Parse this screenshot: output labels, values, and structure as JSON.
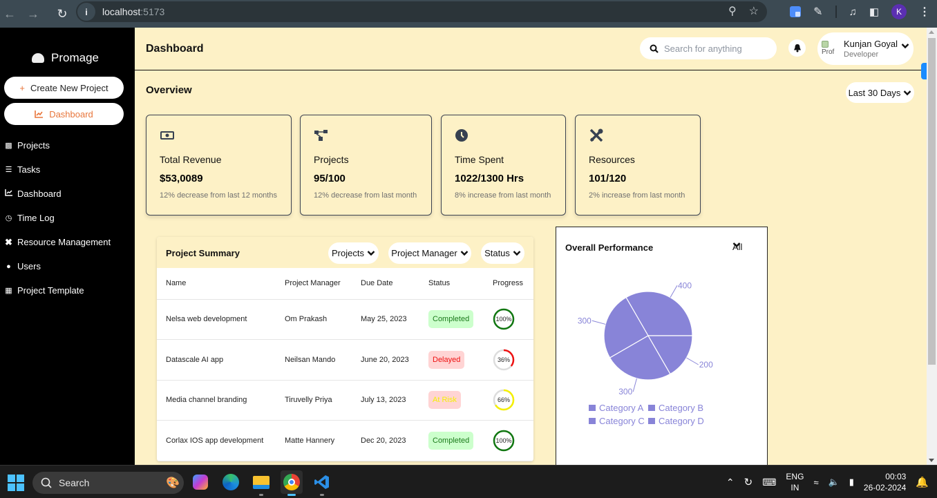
{
  "browser": {
    "url_host": "localhost",
    "url_port": ":5173",
    "profile_initial": "K"
  },
  "sidebar": {
    "brand": "Promage",
    "create_button": "Create New Project",
    "active_button": "Dashboard",
    "items": [
      {
        "label": "Projects",
        "icon": "project-diagram-icon"
      },
      {
        "label": "Tasks",
        "icon": "task-list-icon"
      },
      {
        "label": "Dashboard",
        "icon": "chart-line-icon"
      },
      {
        "label": "Time Log",
        "icon": "clock-icon"
      },
      {
        "label": "Resource Management",
        "icon": "tools-icon"
      },
      {
        "label": "Users",
        "icon": "users-icon"
      },
      {
        "label": "Project Template",
        "icon": "clipboard-icon"
      }
    ]
  },
  "header": {
    "title": "Dashboard",
    "search_placeholder": "Search for anything",
    "user": {
      "name": "Kunjan Goyal",
      "role": "Developer",
      "avatar_alt": "Prof"
    }
  },
  "overview": {
    "title": "Overview",
    "period": "Last 30 Days",
    "cards": [
      {
        "icon": "money-bill-icon",
        "label": "Total Revenue",
        "value": "$53,0089",
        "note": "12% decrease from last 12 months"
      },
      {
        "icon": "project-diagram-icon",
        "label": "Projects",
        "value": "95/100",
        "note": "12% decrease from last month"
      },
      {
        "icon": "clock-icon",
        "label": "Time Spent",
        "value": "1022/1300 Hrs",
        "note": "8% increase from last month"
      },
      {
        "icon": "tools-icon",
        "label": "Resources",
        "value": "101/120",
        "note": "2% increase from last month"
      }
    ]
  },
  "summary": {
    "title": "Project Summary",
    "filters": [
      "Projects",
      "Project Manager",
      "Status"
    ],
    "columns": [
      "Name",
      "Project Manager",
      "Due Date",
      "Status",
      "Progress"
    ],
    "rows": [
      {
        "name": "Nelsa web development",
        "manager": "Om Prakash",
        "due": "May 25, 2023",
        "status": "Completed",
        "progress": 100,
        "progress_label": "100%"
      },
      {
        "name": "Datascale AI app",
        "manager": "Neilsan Mando",
        "due": "June 20, 2023",
        "status": "Delayed",
        "progress": 36,
        "progress_label": "36%"
      },
      {
        "name": "Media channel branding",
        "manager": "Tiruvelly Priya",
        "due": "July 13, 2023",
        "status": "At Risk",
        "progress": 66,
        "progress_label": "66%"
      },
      {
        "name": "Corlax IOS app development",
        "manager": "Matte Hannery",
        "due": "Dec 20, 2023",
        "status": "Completed",
        "progress": 100,
        "progress_label": "100%"
      }
    ],
    "status_colors": {
      "Completed": {
        "bg": "#ccffcc",
        "fg": "#1a7a1a",
        "ring": "#117711"
      },
      "Delayed": {
        "bg": "#ffd4d4",
        "fg": "#ee1111",
        "ring": "#ee1111"
      },
      "At Risk": {
        "bg": "#ffd4d4",
        "fg": "#f5f000",
        "ring": "#f5f000"
      }
    }
  },
  "performance": {
    "title": "Overall Performance",
    "filter": "All"
  },
  "chart_data": {
    "type": "pie",
    "title": "Overall Performance",
    "categories": [
      "Category A",
      "Category B",
      "Category C",
      "Category D"
    ],
    "values": [
      400,
      300,
      300,
      200
    ],
    "color": "#8884d8",
    "legend": "bottom",
    "data_labels": [
      "400",
      "300",
      "300",
      "200"
    ]
  },
  "taskbar": {
    "search_label": "Search",
    "lang_line1": "ENG",
    "lang_line2": "IN",
    "time": "00:03",
    "date": "26-02-2024"
  }
}
